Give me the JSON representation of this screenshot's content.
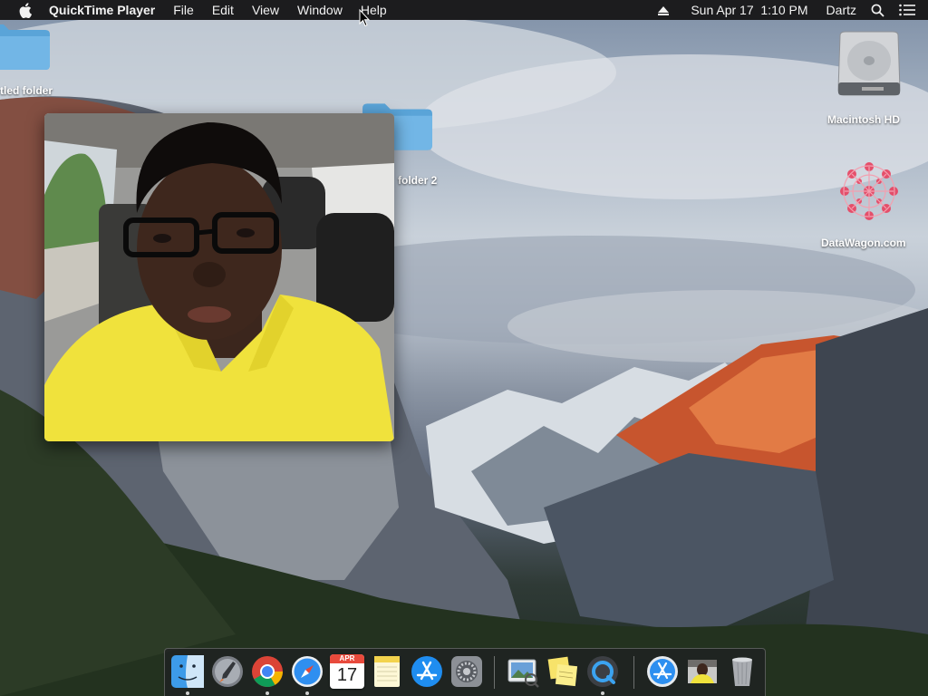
{
  "menubar": {
    "app_name": "QuickTime Player",
    "menus": [
      "File",
      "Edit",
      "View",
      "Window",
      "Help"
    ],
    "datetime": "Sun Apr 17  1:10 PM",
    "user": "Dartz"
  },
  "desktop": {
    "icons": [
      {
        "label": "tled folder",
        "icon": "folder-icon"
      },
      {
        "label": "folder 2",
        "icon": "folder-icon"
      },
      {
        "label": "Macintosh HD",
        "icon": "hard-drive-icon"
      },
      {
        "label": "DataWagon.com",
        "icon": "datawagon-icon"
      }
    ]
  },
  "video_window": {
    "content": "facetime-recording-video"
  },
  "dock": {
    "calendar": {
      "month": "APR",
      "day": "17"
    },
    "items": [
      "finder",
      "launchpad",
      "chrome",
      "safari",
      "calendar",
      "notes",
      "app-store",
      "system-preferences",
      "preview",
      "stickies",
      "quicktime",
      "app-store-download",
      "photo-thumbnail",
      "trash"
    ]
  }
}
